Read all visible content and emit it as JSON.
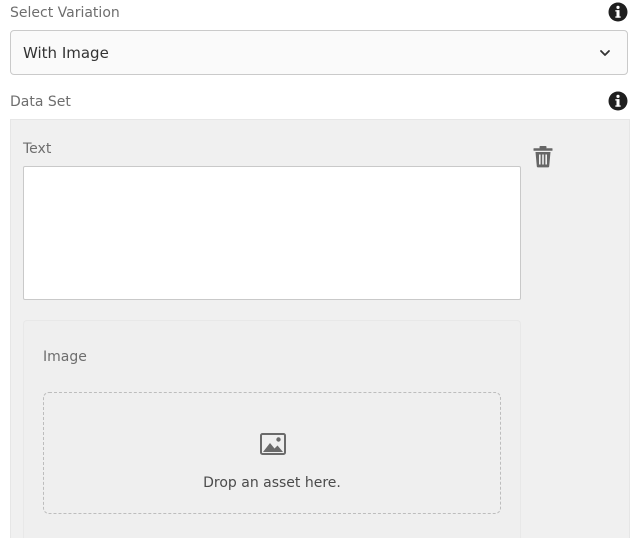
{
  "variation": {
    "label": "Select Variation",
    "selected": "With Image",
    "info_icon": "info-icon",
    "chevron_icon": "chevron-down-icon"
  },
  "dataset": {
    "label": "Data Set",
    "info_icon": "info-icon",
    "text_field": {
      "label": "Text",
      "value": ""
    },
    "delete_icon": "trash-icon",
    "image": {
      "label": "Image",
      "drop_text": "Drop an asset here.",
      "icon": "image-icon"
    }
  },
  "colors": {
    "panel_bg": "#f0f0f0",
    "text": "#4b4b4b",
    "label": "#6e6e6e",
    "icon": "#1f1f1f"
  }
}
